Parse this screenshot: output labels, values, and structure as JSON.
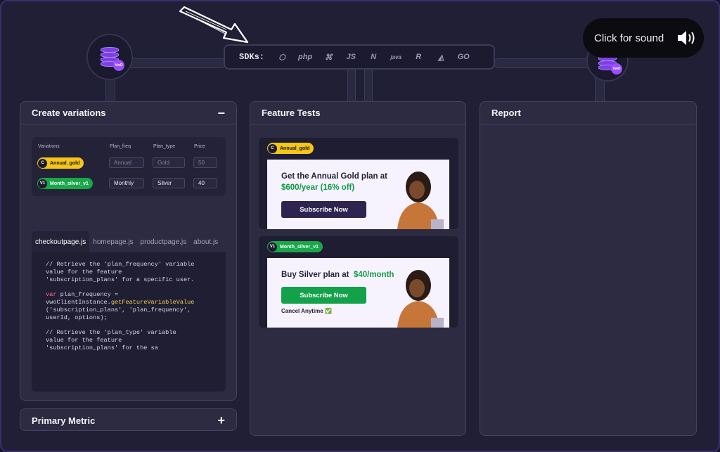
{
  "sdk_bar": {
    "label": "SDKs:",
    "items": [
      {
        "name": "nodejs",
        "text": "⬡"
      },
      {
        "name": "php",
        "text": "php"
      },
      {
        "name": "python",
        "text": "⌘"
      },
      {
        "name": "js",
        "text": "JS"
      },
      {
        "name": "dotnet",
        "text": "N"
      },
      {
        "name": "java",
        "text": "java"
      },
      {
        "name": "ruby",
        "text": "R"
      },
      {
        "name": "flutter",
        "text": "◭"
      },
      {
        "name": "go",
        "text": "GO"
      }
    ]
  },
  "sound_button": {
    "label": "Click for sound"
  },
  "create_panel": {
    "title": "Create variations",
    "collapse_symbol": "−",
    "columns": [
      "Variations",
      "Plan_freq",
      "Plan_type",
      "Price"
    ],
    "rows": [
      {
        "badge_letter": "C",
        "badge_label": "Annual_gold",
        "badge_color": "#f5c518",
        "plan_freq": "Annual",
        "plan_type": "Gold",
        "price": "50"
      },
      {
        "badge_letter": "V1",
        "badge_label": "Month_silver_v1",
        "badge_color": "#19a74a",
        "plan_freq": "Monthly",
        "plan_type": "Silver",
        "price": "40"
      }
    ],
    "file_tabs": [
      "checkoutpage.js",
      "homepage.js",
      "productpage.js",
      "about.js"
    ],
    "active_tab": "checkoutpage.js",
    "code": {
      "c1": "// Retrieve the 'plan_frequency' variable",
      "c2": "value for the feature",
      "c3": "'subscription_plans' for a specific user.",
      "kw1": "var",
      "l1": " plan_frequency =",
      "l2": "vwoClientInstance.",
      "fn1": "getFeatureVariableValue",
      "l3": "('subscription_plans', 'plan_frequency',",
      "l4": "userId, options);",
      "c4": "// Retrieve the 'plan_type' variable",
      "c5": "value for the feature",
      "c6": "'subscription_plans' for the sa"
    }
  },
  "metric_panel": {
    "title": "Primary Metric",
    "expand_symbol": "+"
  },
  "feature_panel": {
    "title": "Feature Tests",
    "cards": [
      {
        "badge_letter": "C",
        "badge_label": "Annual_gold",
        "badge_color": "#f5c518",
        "headline": "Get the Annual Gold plan at",
        "price": "$600/year (16% off)",
        "button": "Subscribe Now",
        "button_color": "#2d2550"
      },
      {
        "badge_letter": "V1",
        "badge_label": "Month_silver_v1",
        "badge_color": "#19a74a",
        "headline": "Buy Silver plan at",
        "price": "$40/month",
        "button": "Subscribe Now",
        "button_color": "#13a14a",
        "footnote": "Cancel Anytime ✅"
      }
    ]
  },
  "report_panel": {
    "title": "Report"
  },
  "colors": {
    "accent": "#7b3fe4",
    "panel": "#2c2b42",
    "gold": "#f5c518",
    "green": "#19a74a"
  }
}
